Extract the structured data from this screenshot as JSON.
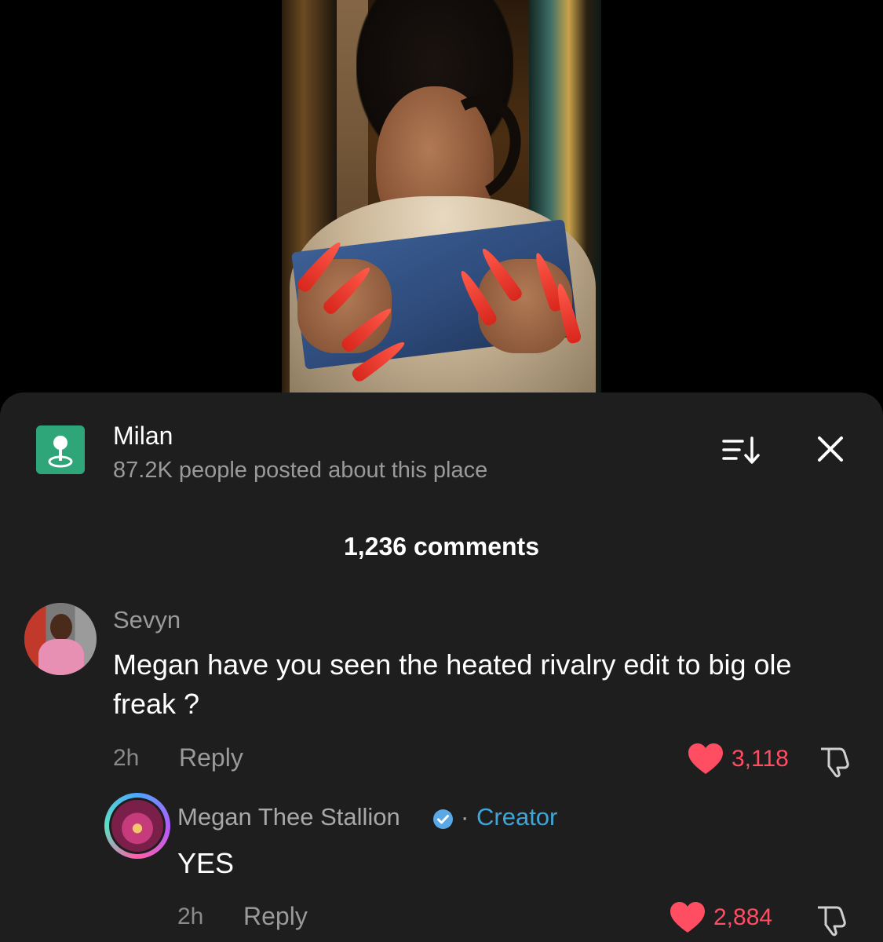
{
  "colors": {
    "sheet_bg": "#1e1e1e",
    "place_icon_bg": "#2fa57a",
    "heart": "#ff4d62",
    "creator_badge": "#3fa6d9",
    "verified": "#5aa8e6"
  },
  "place": {
    "icon": "location-pin-icon",
    "title": "Milan",
    "subtitle": "87.2K people posted about this place"
  },
  "header": {
    "sort_icon": "sort-icon",
    "close_icon": "close-icon",
    "comment_count": "1,236 comments"
  },
  "comments": [
    {
      "username": "Sevyn",
      "text": "Megan have you seen the heated rivalry edit to big ole freak ?",
      "time": "2h",
      "reply_label": "Reply",
      "likes": "3,118",
      "liked": true
    }
  ],
  "reply": {
    "username": "Megan Thee Stallion",
    "verified": true,
    "separator": "·",
    "badge": "Creator",
    "text": "YES",
    "time": "2h",
    "reply_label": "Reply",
    "likes": "2,884",
    "liked": true
  }
}
